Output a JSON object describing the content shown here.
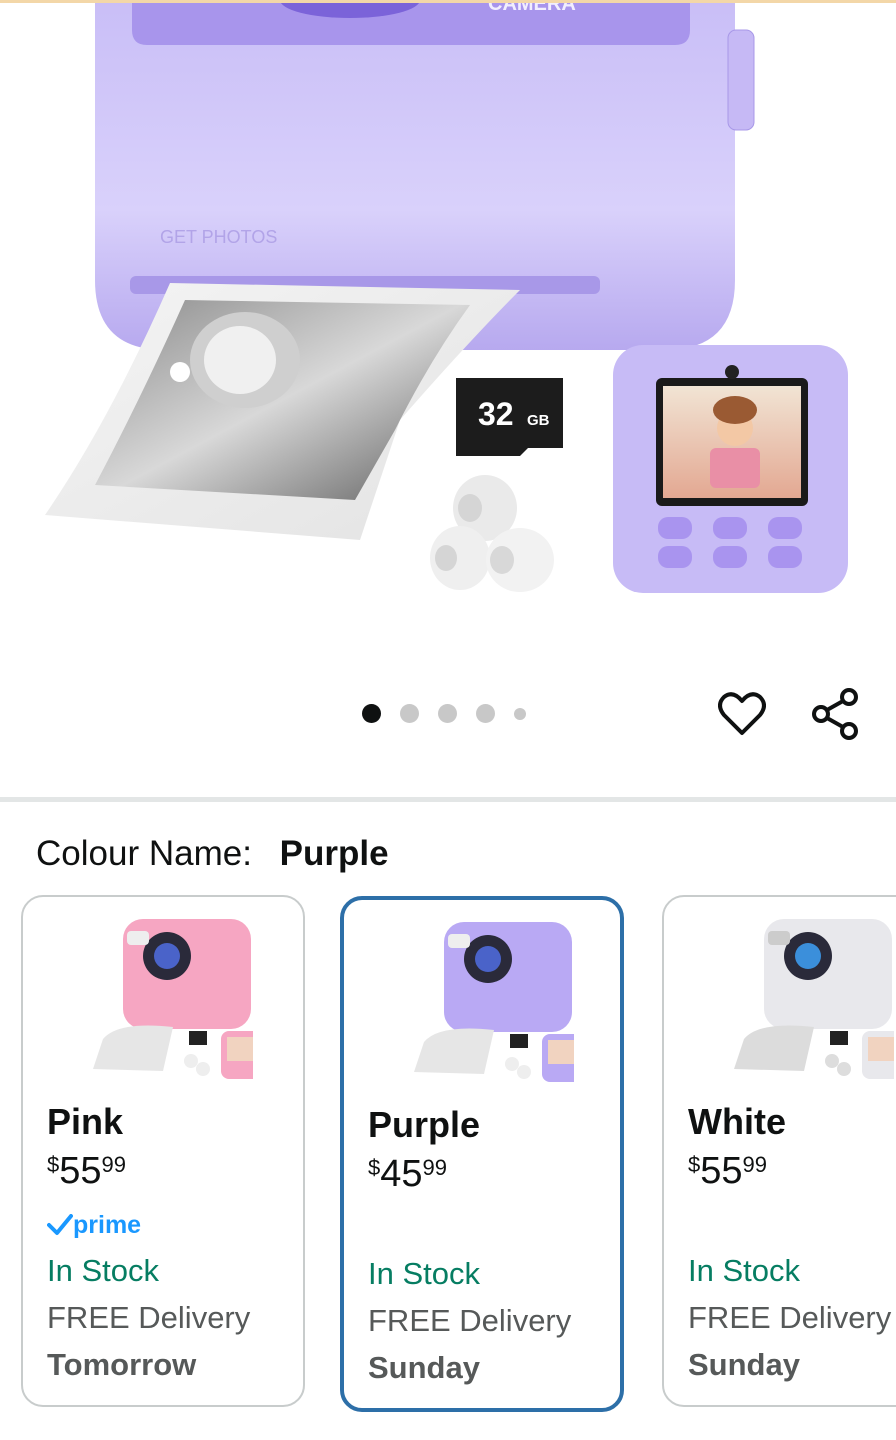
{
  "product_image": {
    "camera_text_top": "CAMERA",
    "get_photos_label": "GET PHOTOS",
    "sd_card_size": "32",
    "sd_card_unit": "GB"
  },
  "carousel": {
    "total_dots": 5,
    "active_index": 0
  },
  "actions": {
    "favorite_icon": "heart-icon",
    "share_icon": "share-icon"
  },
  "colour": {
    "label": "Colour Name:",
    "selected": "Purple"
  },
  "variants": [
    {
      "name": "Pink",
      "price_symbol": "$",
      "price_whole": "55",
      "price_cents": "99",
      "prime": true,
      "prime_label": "prime",
      "stock": "In Stock",
      "delivery": "FREE Delivery",
      "delivery_day": "Tomorrow",
      "color": "#f6a6c2",
      "selected": false
    },
    {
      "name": "Purple",
      "price_symbol": "$",
      "price_whole": "45",
      "price_cents": "99",
      "prime": false,
      "stock": "In Stock",
      "delivery": "FREE Delivery",
      "delivery_day": "Sunday",
      "color": "#b9a9f4",
      "selected": true
    },
    {
      "name": "White",
      "price_symbol": "$",
      "price_whole": "55",
      "price_cents": "99",
      "prime": false,
      "stock": "In Stock",
      "delivery": "FREE Delivery",
      "delivery_day": "Sunday",
      "color": "#e8e8ec",
      "selected": false
    }
  ]
}
